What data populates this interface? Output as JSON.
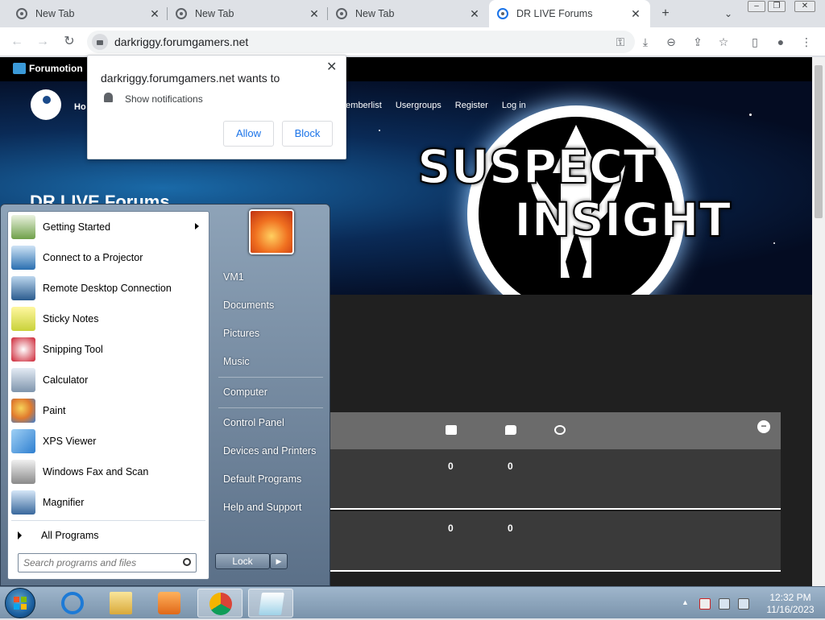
{
  "browser": {
    "tabs": [
      {
        "title": "New Tab"
      },
      {
        "title": "New Tab"
      },
      {
        "title": "New Tab"
      },
      {
        "title": "DR LIVE Forums"
      }
    ],
    "url": "darkriggy.forumgamers.net"
  },
  "notification_prompt": {
    "title": "darkriggy.forumgamers.net wants to",
    "permission": "Show notifications",
    "allow_label": "Allow",
    "block_label": "Block"
  },
  "page": {
    "forumotion_label": "Forumotion",
    "nav": [
      "Memberlist",
      "Usergroups",
      "Register",
      "Log in"
    ],
    "nav_partial_home": "Ho",
    "forum_title": "DR LIVE Forums",
    "logo_line1": "SUSPECT",
    "logo_line2": "INSIGHT",
    "rows": [
      {
        "topics": "0",
        "posts": "0"
      },
      {
        "topics": "0",
        "posts": "0"
      }
    ]
  },
  "start_menu": {
    "programs": [
      {
        "label": "Getting Started",
        "icon": "getting-started-icon",
        "has_submenu": true
      },
      {
        "label": "Connect to a Projector",
        "icon": "projector-icon"
      },
      {
        "label": "Remote Desktop Connection",
        "icon": "remote-desktop-icon"
      },
      {
        "label": "Sticky Notes",
        "icon": "sticky-notes-icon"
      },
      {
        "label": "Snipping Tool",
        "icon": "snipping-tool-icon"
      },
      {
        "label": "Calculator",
        "icon": "calculator-icon"
      },
      {
        "label": "Paint",
        "icon": "paint-icon"
      },
      {
        "label": "XPS Viewer",
        "icon": "xps-viewer-icon"
      },
      {
        "label": "Windows Fax and Scan",
        "icon": "fax-icon"
      },
      {
        "label": "Magnifier",
        "icon": "magnifier-icon"
      }
    ],
    "all_programs": "All Programs",
    "search_placeholder": "Search programs and files",
    "right_links": [
      "VM1",
      "Documents",
      "Pictures",
      "Music",
      "Computer",
      "Control Panel",
      "Devices and Printers",
      "Default Programs",
      "Help and Support"
    ],
    "lock_label": "Lock"
  },
  "taskbar": {
    "time": "12:32 PM",
    "date": "11/16/2023"
  }
}
